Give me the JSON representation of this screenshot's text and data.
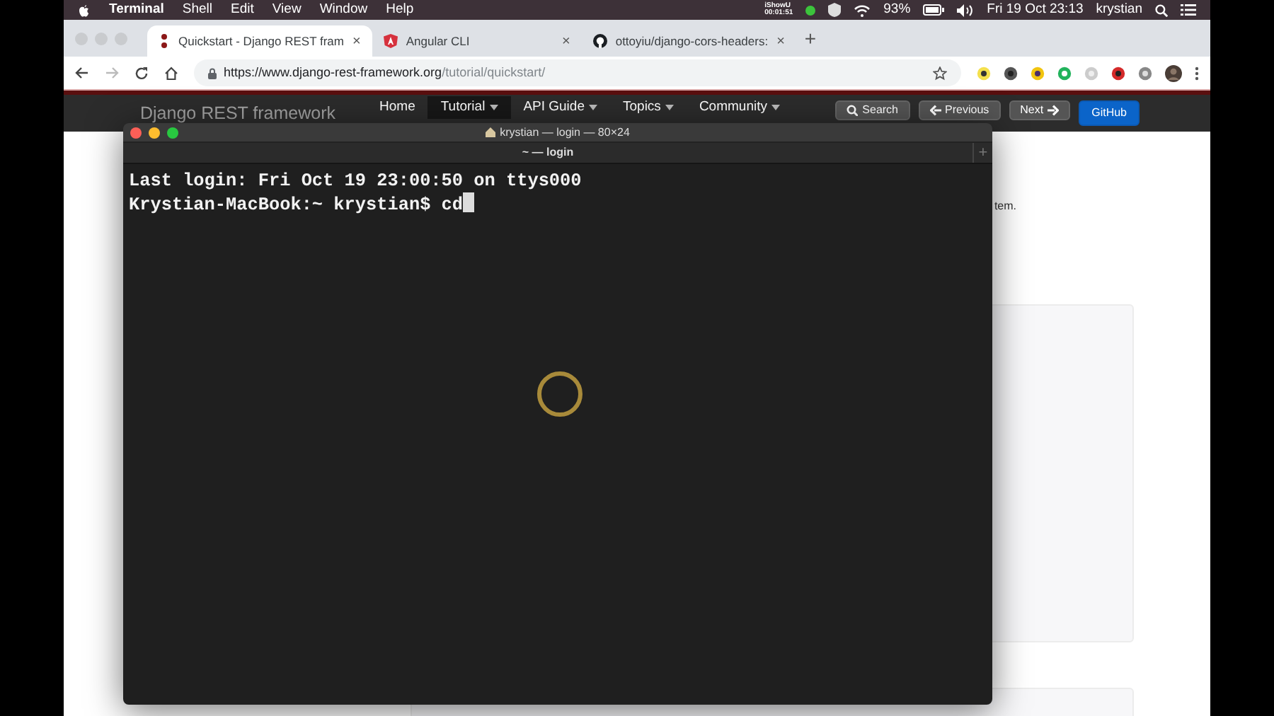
{
  "menubar": {
    "app": "Terminal",
    "menus": [
      "Shell",
      "Edit",
      "View",
      "Window",
      "Help"
    ],
    "recorder": {
      "name": "iShowU",
      "time": "00:01:51"
    },
    "battery": "93%",
    "clock": "Fri 19 Oct  23:13",
    "user": "krystian"
  },
  "browser": {
    "tabs": [
      {
        "title": "Quickstart - Django REST fram",
        "kind": "django",
        "close": "×",
        "selected": true
      },
      {
        "title": "Angular CLI",
        "kind": "angular",
        "close": "×",
        "selected": false
      },
      {
        "title": "ottoyiu/django-cors-headers:",
        "kind": "github",
        "close": "×",
        "selected": false
      }
    ],
    "new_tab": "+",
    "url": {
      "host": "https://www.django-rest-framework.org",
      "path": "/tutorial/quickstart/"
    }
  },
  "site": {
    "brand": "Django REST framework",
    "nav": [
      {
        "label": "Home",
        "dropdown": false,
        "selected": false
      },
      {
        "label": "Tutorial",
        "dropdown": true,
        "selected": true
      },
      {
        "label": "API Guide",
        "dropdown": true,
        "selected": false
      },
      {
        "label": "Topics",
        "dropdown": true,
        "selected": false
      },
      {
        "label": "Community",
        "dropdown": true,
        "selected": false
      }
    ],
    "buttons": [
      {
        "label": "Search",
        "kind": "search"
      },
      {
        "label": "Previous",
        "kind": "previous"
      },
      {
        "label": "Next",
        "kind": "next"
      },
      {
        "label": "GitHub",
        "kind": "github"
      }
    ],
    "text_fragment": "tem."
  },
  "terminal": {
    "title": "krystian — login — 80×24",
    "tab_title": "~ — login",
    "new_tab": "+",
    "lines": [
      "Last login: Fri Oct 19 23:00:50 on ttys000",
      "Krystian-MacBook:~ krystian$ cd"
    ]
  }
}
